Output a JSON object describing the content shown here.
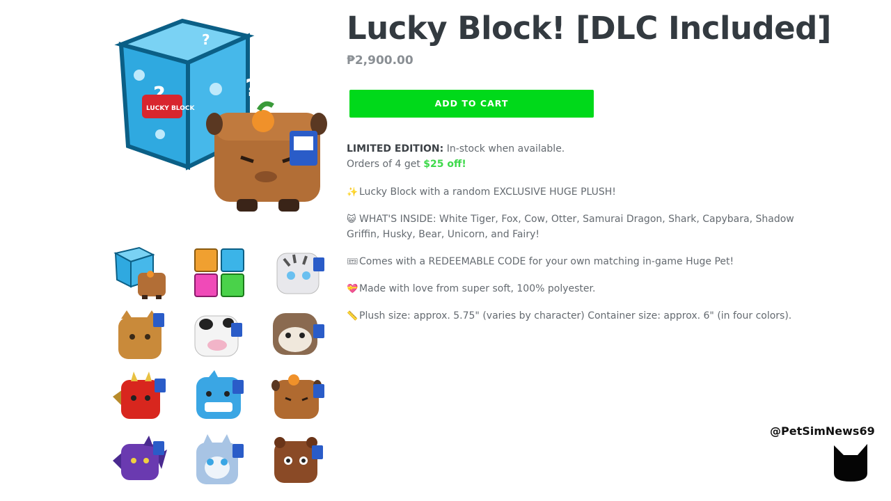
{
  "product": {
    "title": "Lucky Block! [DLC Included]",
    "price": "₱2,900.00",
    "add_to_cart_label": "ADD TO CART"
  },
  "description": {
    "limited_label": "LIMITED EDITION:",
    "limited_text": " In-stock when available.",
    "orders_prefix": "Orders of 4 get ",
    "orders_discount": "$25 off!",
    "bullets": [
      {
        "emoji": "✨",
        "text": "Lucky Block with a random EXCLUSIVE HUGE PLUSH!"
      },
      {
        "emoji": "😺",
        "text": "WHAT'S INSIDE: White Tiger, Fox, Cow, Otter, Samurai Dragon, Shark, Capybara, Shadow Griffin, Husky, Bear, Unicorn, and Fairy!"
      },
      {
        "emoji": "🎟",
        "text": "Comes with a REDEEMABLE CODE for your own matching in-game Huge Pet!"
      },
      {
        "emoji": "💝",
        "text": "Made with love from super soft, 100% polyester."
      },
      {
        "emoji": "📏",
        "text": "Plush size: approx. 5.75\" (varies by character) Container size: approx. 6\" (in four colors)."
      }
    ]
  },
  "watermark": {
    "handle": "@PetSimNews69"
  },
  "thumbnails": [
    {
      "name": "lucky-block-capybara-thumb",
      "kind": "box-capy",
      "color": "#3bb4e8"
    },
    {
      "name": "four-color-boxes-thumb",
      "kind": "boxes",
      "color": "#f0a030"
    },
    {
      "name": "white-tiger-thumb",
      "kind": "plush",
      "color": "#e8e8ec"
    },
    {
      "name": "fox-thumb",
      "kind": "plush",
      "color": "#c98a3a"
    },
    {
      "name": "cow-thumb",
      "kind": "plush",
      "color": "#f4f4f4"
    },
    {
      "name": "otter-thumb",
      "kind": "plush",
      "color": "#8a6a50"
    },
    {
      "name": "samurai-dragon-thumb",
      "kind": "plush",
      "color": "#d8261e"
    },
    {
      "name": "shark-thumb",
      "kind": "plush",
      "color": "#3aa6e4"
    },
    {
      "name": "capybara-thumb",
      "kind": "plush",
      "color": "#b06a30"
    },
    {
      "name": "shadow-griffin-thumb",
      "kind": "plush",
      "color": "#6a3ab0"
    },
    {
      "name": "husky-thumb",
      "kind": "plush",
      "color": "#a8c4e4"
    },
    {
      "name": "bear-thumb",
      "kind": "plush",
      "color": "#8a4a26"
    }
  ],
  "colors": {
    "accent_button": "#00d91a",
    "discount_green": "#3ed94b",
    "title": "#333a40"
  }
}
